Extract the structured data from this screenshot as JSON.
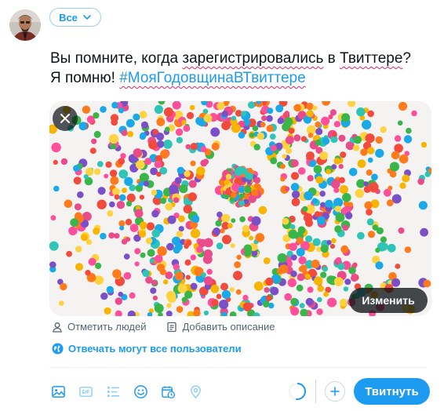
{
  "audience": {
    "label": "Все"
  },
  "tweet": {
    "line1_prefix": "Вы помните, когда ",
    "line1_underlined": "зарегистрировались",
    "line1_mid": " в ",
    "line1_underlined2": "Твиттере",
    "line1_suffix": "?",
    "line2_prefix": "Я помню! ",
    "hashtag": "#МояГодовщинаВТвиттере"
  },
  "media": {
    "edit_label": "Изменить",
    "tag_people": "Отметить людей",
    "add_description": "Добавить описание",
    "image_number": "9"
  },
  "reply_setting": "Отвечать могут все пользователи",
  "compose": {
    "tweet_button": "Твитнуть"
  },
  "colors": {
    "accent": "#1d9bf0",
    "spell_error": "#e0245e"
  },
  "icons": {
    "toolbar": [
      "image-icon",
      "gif-icon",
      "poll-icon",
      "emoji-icon",
      "schedule-icon",
      "location-icon"
    ]
  }
}
